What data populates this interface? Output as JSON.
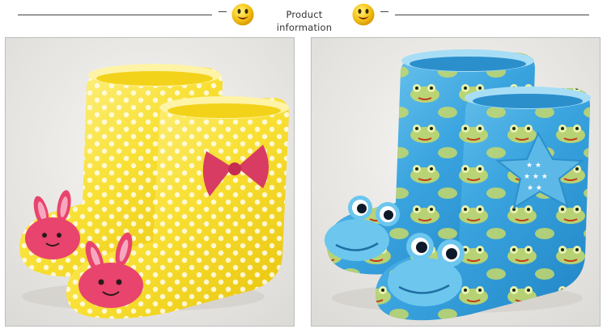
{
  "header": {
    "title": "Product information",
    "left_icon": "smiley-icon",
    "right_icon": "smiley-icon"
  },
  "products": [
    {
      "name": "yellow-dotted-rain-boots",
      "color": "#f6dd2c",
      "decoration": "pink-bunny-face"
    },
    {
      "name": "blue-frog-rain-boots",
      "color": "#3aa4df",
      "decoration": "frog-face"
    }
  ],
  "colors": {
    "rule": "#444444",
    "smiley": "#f7c619",
    "panel_border": "#bdbdbd"
  }
}
